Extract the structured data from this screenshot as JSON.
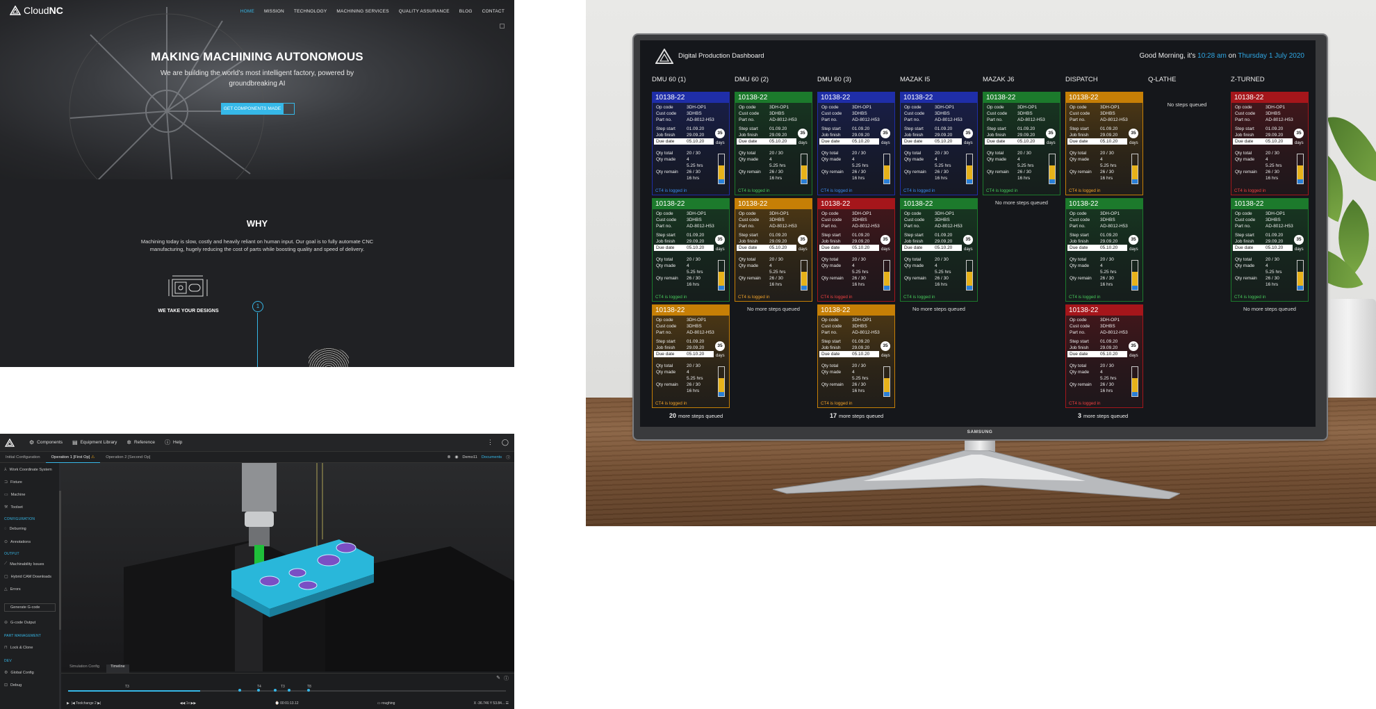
{
  "website": {
    "logo": {
      "text_a": "Cloud",
      "text_b": "NC"
    },
    "nav": [
      "HOME",
      "MISSION",
      "TECHNOLOGY",
      "MACHINING SERVICES",
      "QUALITY ASSURANCE",
      "BLOG",
      "CONTACT"
    ],
    "hero": {
      "title": "MAKING MACHINING AUTONOMOUS",
      "subtitle": "We are building the world's most intelligent factory, powered by groundbreaking AI",
      "cta": "GET COMPONENTS MADE"
    },
    "why": {
      "title": "WHY",
      "text": "Machining today is slow, costly and heavily reliant on human input. Our goal is to fully automate CNC manufacturing, hugely reducing the cost of parts while boosting quality and speed of delivery.",
      "step_number": "1",
      "step_label": "WE TAKE YOUR DESIGNS"
    }
  },
  "cam": {
    "nav": [
      {
        "icon": "components-icon",
        "label": "Components"
      },
      {
        "icon": "library-icon",
        "label": "Equipment Library"
      },
      {
        "icon": "reference-icon",
        "label": "Reference"
      },
      {
        "icon": "help-icon",
        "label": "Help"
      }
    ],
    "tabs": [
      "Initial Configuration",
      "Operation 1 [First Op]",
      "Operation 2 [Second Op]"
    ],
    "active_tab": "Operation 1 [First Op]",
    "user": "Demo11",
    "documents": "Documents",
    "sidebar": {
      "items_top": [
        "Work Coordinate System",
        "Fixture",
        "Machine",
        "Toolset"
      ],
      "configuration_head": "CONFIGURATION",
      "items_config": [
        "Deburring",
        "Annotations"
      ],
      "output_head": "OUTPUT",
      "items_output": [
        "Machinability Issues",
        "Hybrid CAM Downloads",
        "Errors"
      ],
      "generate_button": "Generate G-code",
      "gcode_output": "G-code Output",
      "part_head": "PART MANAGEMENT",
      "lock_clone": "Lock & Clone",
      "dev_head": "DEV",
      "global_config": "Global Config",
      "debug": "Debug"
    },
    "bottom_tabs": [
      "Simulation Config",
      "Timeline"
    ],
    "timeline": {
      "markers": [
        "T3",
        "T4",
        "T3",
        "T8"
      ],
      "toolchange": "Toolchange 2",
      "speed": "1x",
      "time": "00:01:13.12",
      "operation": "roughing",
      "coords": "X -36.746  Y 53.84..."
    }
  },
  "dashboard": {
    "title": "Digital Production Dashboard",
    "greeting": "Good Morning, it's",
    "time": "10:28 am",
    "on": "on",
    "date": "Thursday 1 July 2020",
    "brand": "SAMSUNG",
    "columns": [
      "DMU 60 (1)",
      "DMU 60 (2)",
      "DMU 60 (3)",
      "MAZAK I5",
      "MAZAK J6",
      "DISPATCH",
      "Q-LATHE",
      "Z-TURNED"
    ],
    "card": {
      "job": "10138-22",
      "labels": {
        "op": "Op code",
        "cust": "Cust code",
        "part": "Part no.",
        "start": "Step start",
        "finish": "Job finish",
        "due": "Due date",
        "total": "Qty total",
        "made": "Qty made",
        "remain": "Qty remain"
      },
      "values": {
        "op": "3DH-OP1",
        "cust": "3DHBS",
        "part": "AD-8012-H53",
        "start": "01.09.20",
        "finish": "29.09.20",
        "due": "05.10.20",
        "total": "20 / 30",
        "made": "4",
        "made_hrs": "5.25 hrs",
        "remain": "26 / 30",
        "remain_hrs": "16 hrs"
      },
      "days": "35",
      "days_label": "days",
      "logged": "CT4 is logged in"
    },
    "no_more": "No more steps queued",
    "no_more_lathe": "No  steps queued",
    "more_label": "more steps queued",
    "more_counts": {
      "dmu1": "20",
      "dmu3": "17",
      "dispatch": "3"
    },
    "status_colors": {
      "blue": "#1f2ea8",
      "green": "#1c7a2c",
      "amber": "#c67f06",
      "red": "#a5161b"
    }
  }
}
